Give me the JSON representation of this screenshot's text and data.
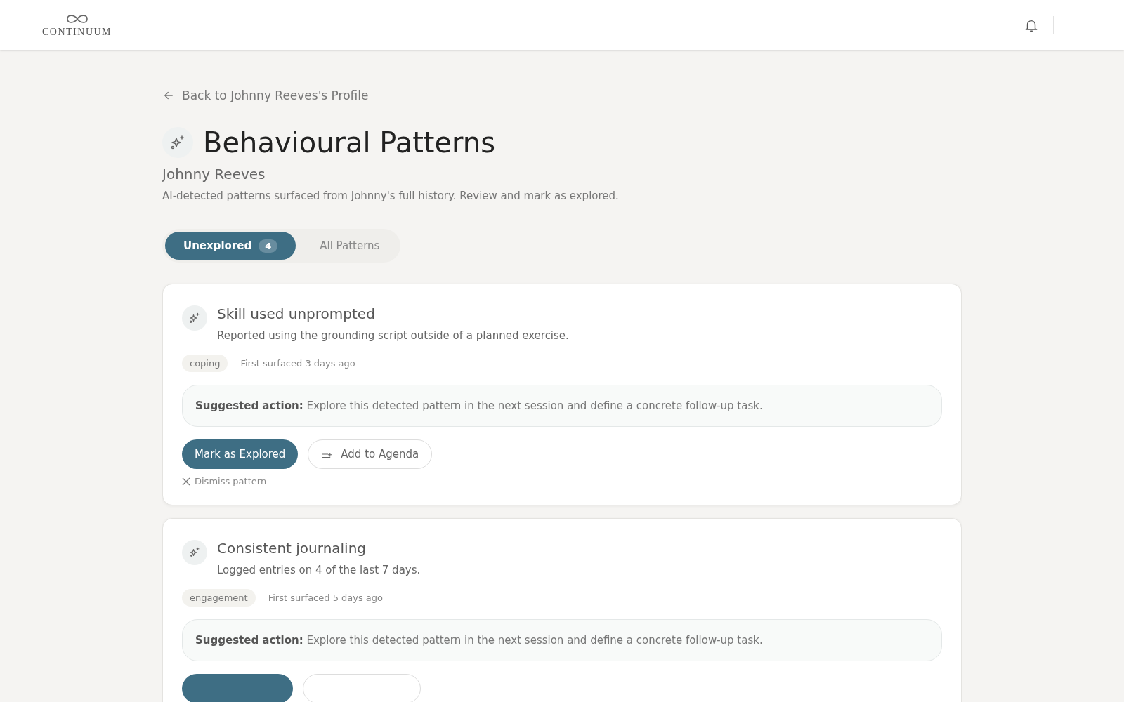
{
  "header": {
    "logo": "CONTINUUM"
  },
  "back_link": "Back to Johnny Reeves's Profile",
  "title": "Behavioural Patterns",
  "subtitle": "Johnny Reeves",
  "description": "AI-detected patterns surfaced from Johnny's full history. Review and mark as explored.",
  "tabs": [
    {
      "label": "Unexplored",
      "count": "4",
      "selected": true
    },
    {
      "label": "All Patterns",
      "selected": false
    }
  ],
  "patterns": [
    {
      "title": "Skill used unprompted",
      "detail": "Reported using the grounding script outside of a planned exercise.",
      "tag": "coping",
      "surfaced": "First surfaced 3 days ago",
      "suggestion": "**Suggested action:** Explore this detected pattern in the next session and define a concrete follow-up task.",
      "buttons": [
        {
          "kind": "primary",
          "label": "Mark as Explored"
        },
        {
          "kind": "agenda",
          "label": "Add to Agenda"
        }
      ],
      "dismiss": "Dismiss pattern"
    },
    {
      "title": "Consistent journaling",
      "detail": "Logged entries on 4 of the last 7 days.",
      "tag": "engagement",
      "surfaced": "First surfaced 5 days ago",
      "suggestion": "**Suggested action:** Explore this detected pattern in the next session and define a concrete follow-up task.",
      "buttons": [
        {
          "kind": "primary"
        },
        {
          "kind": "agenda"
        }
      ]
    }
  ]
}
